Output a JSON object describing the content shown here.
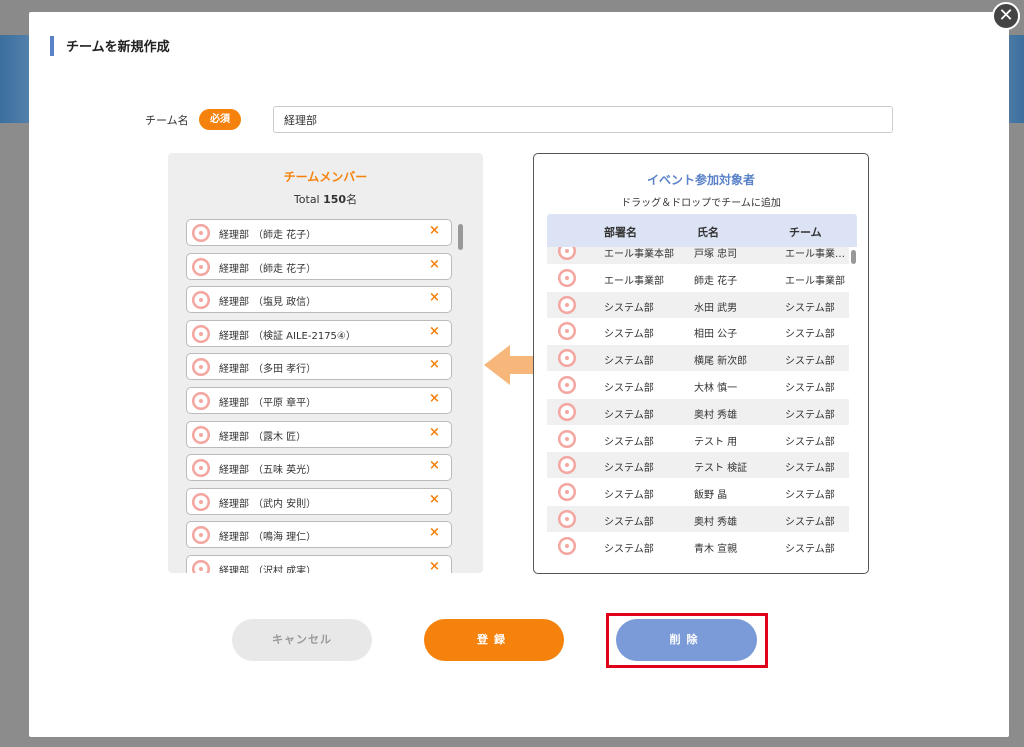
{
  "modal": {
    "title": "チームを新規作成",
    "close_glyph": "✕"
  },
  "team_name": {
    "label": "チーム名",
    "required_badge": "必須",
    "value": "経理部"
  },
  "members": {
    "title": "チームメンバー",
    "total_prefix": "Total ",
    "total_count": "150",
    "total_suffix": "名",
    "items": [
      {
        "dept": "経理部",
        "name": "（師走 花子）"
      },
      {
        "dept": "経理部",
        "name": "（師走 花子）"
      },
      {
        "dept": "経理部",
        "name": "（塩見 政信）"
      },
      {
        "dept": "経理部",
        "name": "（検証 AILE-2175④）"
      },
      {
        "dept": "経理部",
        "name": "（多田 孝行）"
      },
      {
        "dept": "経理部",
        "name": "（平原 章平）"
      },
      {
        "dept": "経理部",
        "name": "（露木 匠）"
      },
      {
        "dept": "経理部",
        "name": "（五味 英光）"
      },
      {
        "dept": "経理部",
        "name": "（武内 安則）"
      },
      {
        "dept": "経理部",
        "name": "（鳴海 理仁）"
      },
      {
        "dept": "経理部",
        "name": "（沢村 成実）"
      }
    ],
    "remove_glyph": "×"
  },
  "participants": {
    "title": "イベント参加対象者",
    "subtitle": "ドラッグ＆ドロップでチームに追加",
    "columns": [
      "部署名",
      "氏名",
      "チーム"
    ],
    "rows": [
      {
        "dept": "エール事業本部",
        "name": "戸塚 忠司",
        "team": "エール事業…"
      },
      {
        "dept": "エール事業部",
        "name": "師走 花子",
        "team": "エール事業部"
      },
      {
        "dept": "システム部",
        "name": "水田 武男",
        "team": "システム部"
      },
      {
        "dept": "システム部",
        "name": "相田 公子",
        "team": "システム部"
      },
      {
        "dept": "システム部",
        "name": "横尾 新次郎",
        "team": "システム部"
      },
      {
        "dept": "システム部",
        "name": "大林 慎一",
        "team": "システム部"
      },
      {
        "dept": "システム部",
        "name": "奥村 秀雄",
        "team": "システム部"
      },
      {
        "dept": "システム部",
        "name": "テスト 用",
        "team": "システム部"
      },
      {
        "dept": "システム部",
        "name": "テスト 検証",
        "team": "システム部"
      },
      {
        "dept": "システム部",
        "name": "飯野 晶",
        "team": "システム部"
      },
      {
        "dept": "システム部",
        "name": "奥村 秀雄",
        "team": "システム部"
      },
      {
        "dept": "システム部",
        "name": "青木 宣親",
        "team": "システム部"
      }
    ]
  },
  "buttons": {
    "cancel": "キャンセル",
    "register": "登録",
    "delete": "削除"
  },
  "colors": {
    "accent_orange": "#f5820c",
    "accent_blue": "#5a82c8",
    "delete_button": "#7b9ad8",
    "highlight": "#e0001a"
  },
  "icons": {
    "avatar": "pinwheel-avatar-icon",
    "arrow": "arrow-left-icon",
    "close": "close-icon"
  }
}
